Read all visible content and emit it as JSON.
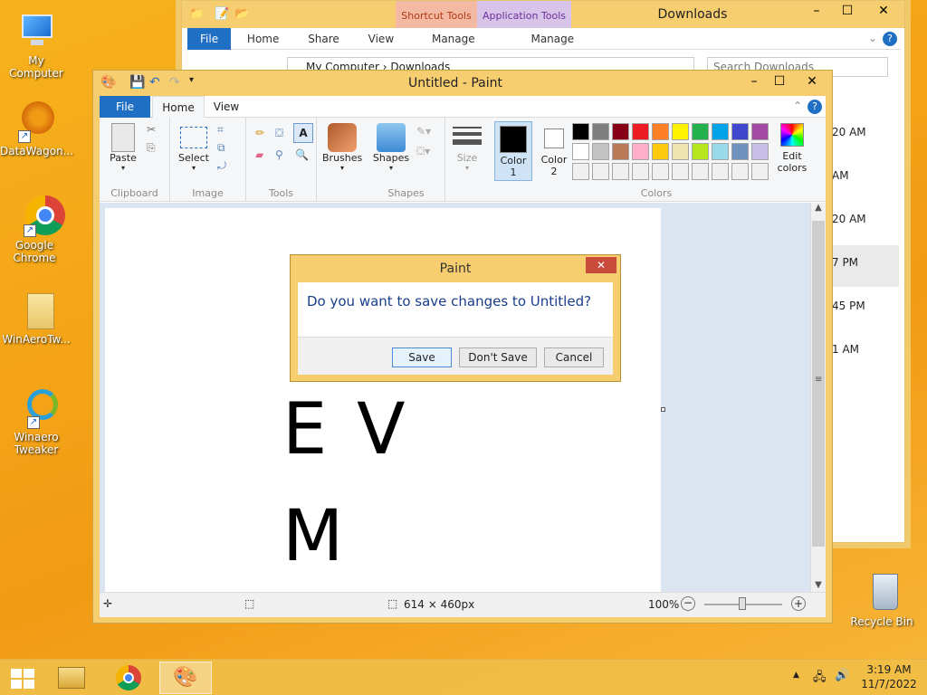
{
  "desktop": {
    "icons": [
      {
        "label": "My Computer"
      },
      {
        "label": "DataWagon..."
      },
      {
        "label": "Google Chrome"
      },
      {
        "label": "WinAeroTw..."
      },
      {
        "label": "Winaero Tweaker"
      },
      {
        "label": "Recycle Bin"
      }
    ]
  },
  "explorer": {
    "title": "Downloads",
    "context_tabs": [
      "Shortcut Tools",
      "Application Tools"
    ],
    "tabs": [
      "File",
      "Home",
      "Share",
      "View",
      "Manage",
      "Manage"
    ],
    "path": [
      "My Computer",
      "Downloads"
    ],
    "search_placeholder": "Search Downloads",
    "times": [
      "20 AM",
      "AM",
      "20 AM",
      "7 PM",
      "45 PM",
      "1 AM"
    ]
  },
  "paint": {
    "title": "Untitled - Paint",
    "tabs": {
      "file": "File",
      "home": "Home",
      "view": "View"
    },
    "groups": {
      "clipboard": "Clipboard",
      "image": "Image",
      "tools": "Tools",
      "shapes": "Shapes",
      "colors": "Colors"
    },
    "buttons": {
      "paste": "Paste",
      "select": "Select",
      "brushes": "Brushes",
      "shapes": "Shapes",
      "size": "Size",
      "color1": "Color\n1",
      "color2": "Color\n2",
      "edit_colors": "Edit\ncolors"
    },
    "palette_row1": [
      "#000000",
      "#7f7f7f",
      "#880015",
      "#ed1c24",
      "#ff7f27",
      "#fff200",
      "#22b14c",
      "#00a2e8",
      "#3f48cc",
      "#a349a4"
    ],
    "palette_row2": [
      "#ffffff",
      "#c3c3c3",
      "#b97a57",
      "#ffaec9",
      "#ffc90e",
      "#efe4b0",
      "#b5e61d",
      "#99d9ea",
      "#7092be",
      "#c8bfe7"
    ],
    "canvas_text": [
      "E V",
      "M"
    ],
    "status": {
      "size": "614 × 460px",
      "zoom": "100%"
    }
  },
  "dialog": {
    "title": "Paint",
    "message": "Do you want to save changes to Untitled?",
    "save": "Save",
    "dont_save": "Don't Save",
    "cancel": "Cancel"
  },
  "taskbar": {
    "time": "3:19 AM",
    "date": "11/7/2022"
  }
}
